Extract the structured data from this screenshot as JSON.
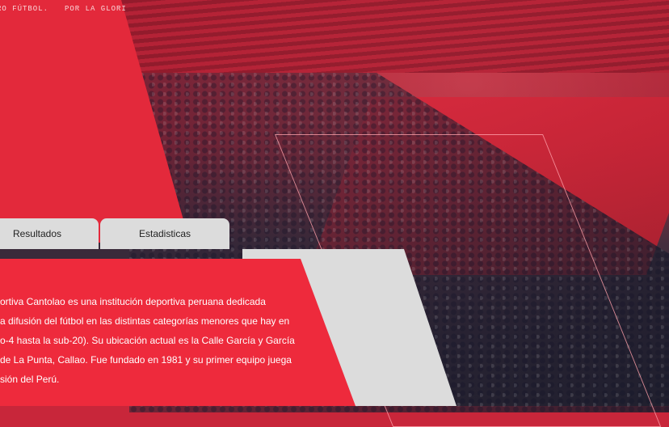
{
  "topbar": {
    "left_text": "RO FÚTBOL.",
    "right_text": "POR LA GLORI"
  },
  "tabs": [
    {
      "label": "Resultados"
    },
    {
      "label": "Estadisticas"
    }
  ],
  "description": {
    "lines": [
      "ortiva Cantolao es una institución deportiva peruana dedicada",
      "a difusión del fútbol en las distintas categorías menores que hay en",
      "o-4 hasta la sub-20). Su ubicación actual es la Calle García y García",
      "de La Punta, Callao. Fue fundado en 1981 y su primer equipo juega",
      "sión del Perú."
    ]
  },
  "colors": {
    "accent_red": "#ee2a3c",
    "panel_gray": "#dcdcdc"
  }
}
